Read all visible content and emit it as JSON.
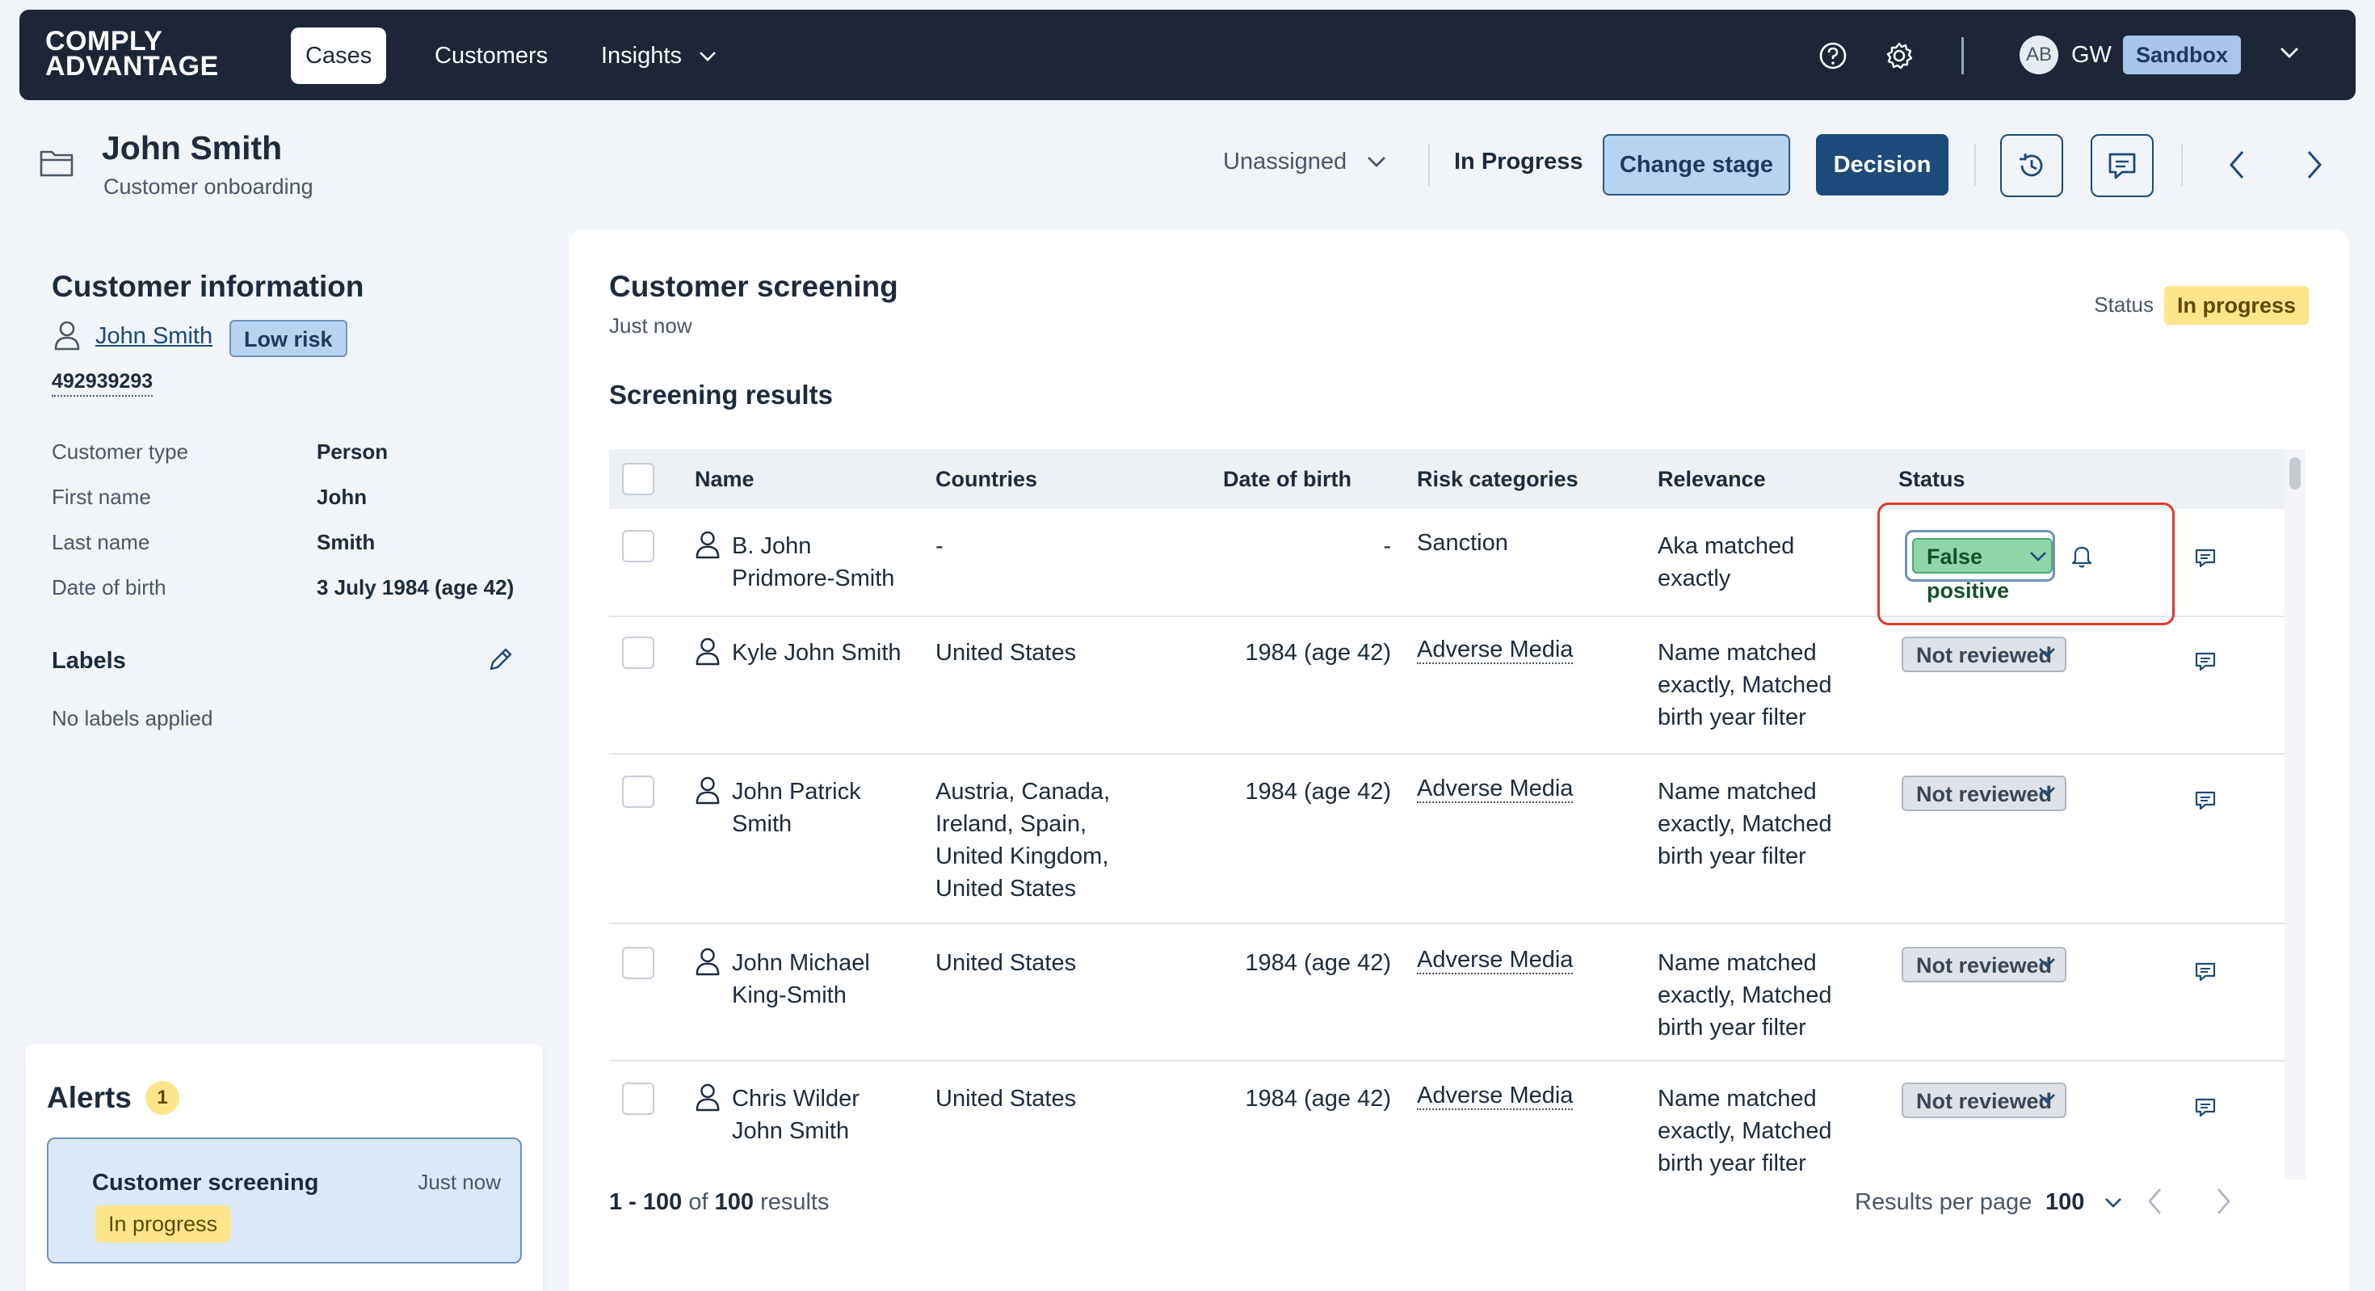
{
  "nav": {
    "logo_line1": "COMPLY",
    "logo_line2": "ADVANTAGE",
    "items": [
      {
        "label": "Cases",
        "active": true
      },
      {
        "label": "Customers",
        "active": false
      },
      {
        "label": "Insights",
        "active": false
      }
    ],
    "icons": [
      "help-icon",
      "settings-icon",
      "chevron-down-icon"
    ],
    "avatar_initials": "AB",
    "user_initials": "GW",
    "env_badge": "Sandbox"
  },
  "header": {
    "title": "John Smith",
    "subtitle": "Customer onboarding",
    "assignee": "Unassigned",
    "stage": "In Progress",
    "change_stage_label": "Change stage",
    "decision_label": "Decision"
  },
  "customer_info": {
    "title": "Customer information",
    "name": "John Smith",
    "risk": "Low risk",
    "id": "492939293",
    "fields": [
      {
        "label": "Customer type",
        "value": "Person"
      },
      {
        "label": "First name",
        "value": "John"
      },
      {
        "label": "Last name",
        "value": "Smith"
      },
      {
        "label": "Date of birth",
        "value": "3 July 1984 (age 42)"
      }
    ],
    "labels_title": "Labels",
    "no_labels": "No labels applied"
  },
  "alerts": {
    "title": "Alerts",
    "count": "1",
    "items": [
      {
        "title": "Customer screening",
        "time": "Just now",
        "status": "In progress"
      }
    ]
  },
  "screening": {
    "title": "Customer screening",
    "time": "Just now",
    "status_label": "Status",
    "status": "In progress",
    "results_title": "Screening results",
    "columns": [
      "Name",
      "Countries",
      "Date of birth",
      "Risk categories",
      "Relevance",
      "Status"
    ],
    "rows": [
      {
        "name": [
          "B. John",
          "Pridmore-Smith"
        ],
        "countries": [
          "-"
        ],
        "dob": "-",
        "risk": "Sanction",
        "relevance": [
          "Aka matched",
          "exactly"
        ],
        "status": "False positive"
      },
      {
        "name": [
          "Kyle John Smith"
        ],
        "countries": [
          "United States"
        ],
        "dob": "1984 (age 42)",
        "risk": "Adverse Media",
        "relevance": [
          "Name matched",
          "exactly, Matched",
          "birth year filter"
        ],
        "status": "Not reviewed"
      },
      {
        "name": [
          "John Patrick",
          "Smith"
        ],
        "countries": [
          "Austria, Canada,",
          "Ireland, Spain,",
          "United Kingdom,",
          "United States"
        ],
        "dob": "1984 (age 42)",
        "risk": "Adverse Media",
        "relevance": [
          "Name matched",
          "exactly, Matched",
          "birth year filter"
        ],
        "status": "Not reviewed"
      },
      {
        "name": [
          "John Michael",
          "King-Smith"
        ],
        "countries": [
          "United States"
        ],
        "dob": "1984 (age 42)",
        "risk": "Adverse Media",
        "relevance": [
          "Name matched",
          "exactly, Matched",
          "birth year filter"
        ],
        "status": "Not reviewed"
      },
      {
        "name": [
          "Chris Wilder",
          "John Smith"
        ],
        "countries": [
          "United States"
        ],
        "dob": "1984 (age 42)",
        "risk": "Adverse Media",
        "relevance": [
          "Name matched",
          "exactly, Matched",
          "birth year filter"
        ],
        "status": "Not reviewed"
      }
    ],
    "results_range": "1 - 100",
    "results_of": "of",
    "results_total": "100",
    "results_word": "results",
    "per_page_label": "Results per page",
    "per_page_value": "100"
  },
  "colors": {
    "nav_bg": "#1c2637",
    "primary": "#1c4a7a",
    "in_progress": "#fde58a",
    "false_positive": "#8fd6aa",
    "highlight": "#e0392b"
  }
}
